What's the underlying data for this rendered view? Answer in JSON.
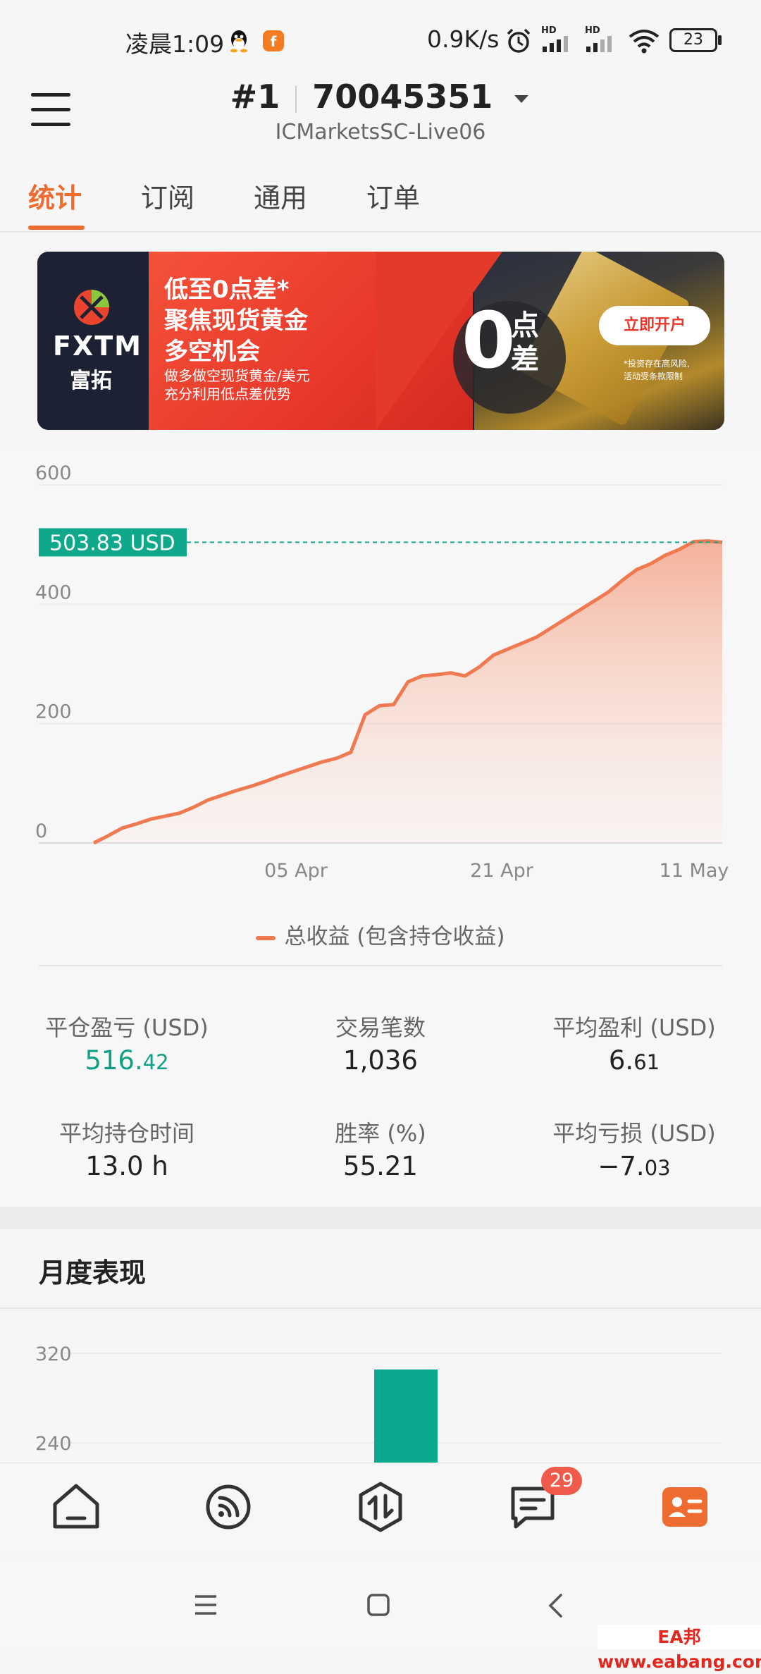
{
  "status_bar": {
    "time": "凌晨1:09",
    "speed": "0.9K/s",
    "hd1": "HD",
    "hd2": "HD",
    "battery": "23"
  },
  "header": {
    "account_index": "#1",
    "account_number": "70045351",
    "server": "ICMarketsSC-Live06"
  },
  "tabs": [
    {
      "label": "统计",
      "active": true
    },
    {
      "label": "订阅",
      "active": false
    },
    {
      "label": "通用",
      "active": false
    },
    {
      "label": "订单",
      "active": false
    }
  ],
  "banner": {
    "brand": "FXTM",
    "brand_cn": "富拓",
    "headline1": "低至0点差*",
    "headline2": "聚焦现货黄金",
    "headline3": "多空机会",
    "sub1": "做多做空现货黄金/美元",
    "sub2": "充分利用低点差优势",
    "big_zero": "0",
    "big_dian": "点",
    "big_cha": "差",
    "cta": "立即开户",
    "disclaimer1": "*投资存在高风险,",
    "disclaimer2": "活动受条款限制"
  },
  "chart_data": {
    "type": "area",
    "ylim": [
      0,
      600
    ],
    "y_ticks": [
      "600",
      "400",
      "200",
      "0"
    ],
    "x_ticks": [
      "05 Apr",
      "21 Apr",
      "11 May"
    ],
    "current_label": "503.83 USD",
    "current_value": 503.83,
    "legend": "总收益 (包含持仓收益)",
    "series": [
      {
        "name": "总收益 (包含持仓收益)",
        "values": [
          0,
          12,
          25,
          32,
          40,
          45,
          50,
          60,
          72,
          80,
          88,
          95,
          103,
          112,
          120,
          128,
          136,
          142,
          152,
          215,
          230,
          232,
          270,
          280,
          282,
          285,
          280,
          295,
          315,
          325,
          335,
          345,
          360,
          375,
          390,
          405,
          420,
          440,
          458,
          468,
          482,
          492,
          505,
          506,
          503.83
        ]
      }
    ],
    "colors": {
      "line": "#ef7a52",
      "fill_top": "#f6b6a0",
      "label_bg": "#10a88a"
    }
  },
  "stats": [
    {
      "label": "平仓盈亏 (USD)",
      "int": "516.",
      "dec": "42",
      "color": "#12a085"
    },
    {
      "label": "交易笔数",
      "int": "1,036",
      "dec": "",
      "color": "#222"
    },
    {
      "label": "平均盈利 (USD)",
      "int": "6.",
      "dec": "61",
      "color": "#222"
    },
    {
      "label": "平均持仓时间",
      "int": "13.0 h",
      "dec": "",
      "color": "#222"
    },
    {
      "label": "胜率 (%)",
      "int": "55.21",
      "dec": "",
      "color": "#222"
    },
    {
      "label": "平均亏损 (USD)",
      "int": "−7.",
      "dec": "03",
      "color": "#222"
    }
  ],
  "monthly": {
    "title": "月度表现",
    "y_ticks": [
      "320",
      "240"
    ],
    "bar_value": 300,
    "bar_color": "#0ba98e"
  },
  "bottom_nav": {
    "items": [
      "home-icon",
      "feed-icon",
      "trade-icon",
      "messages-icon",
      "profile-icon"
    ],
    "badge": "29",
    "active_color": "#ef6c30"
  },
  "watermark": "EA邦www.eabang.com"
}
